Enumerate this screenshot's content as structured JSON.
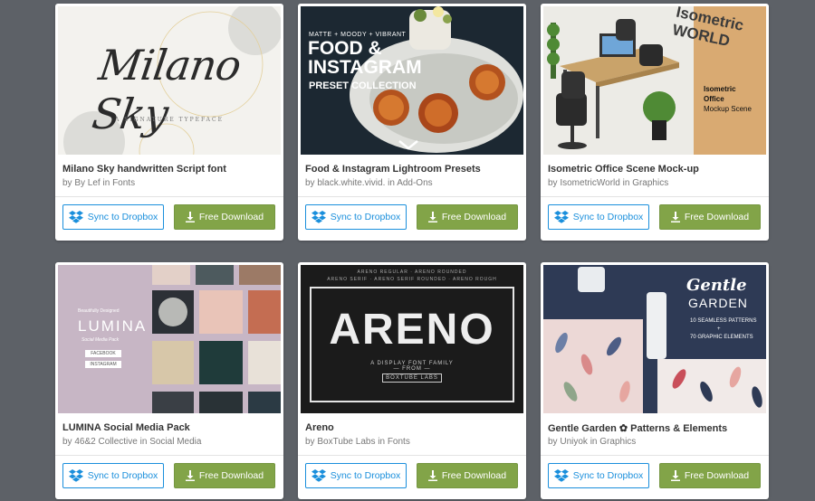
{
  "labels": {
    "sync": "Sync to Dropbox",
    "download": "Free Download"
  },
  "colors": {
    "background": "#5d6167",
    "sync_blue": "#1a8fdc",
    "download_green": "#82a448"
  },
  "cards": [
    {
      "title": "Milano Sky handwritten Script font",
      "by": "by",
      "author": "By Lef",
      "in": "in",
      "category": "Fonts",
      "thumb": {
        "script": "Milano Sky",
        "subtitle": "A SIGNATURE TYPEFACE"
      }
    },
    {
      "title": "Food & Instagram Lightroom Presets",
      "by": "by",
      "author": "black.white.vivid.",
      "in": "in",
      "category": "Add-Ons",
      "thumb": {
        "line1": "MATTE + MOODY + VIBRANT",
        "line2a": "FOOD &",
        "line2b": "INSTAGRAM",
        "line3": "PRESET COLLECTION"
      }
    },
    {
      "title": "Isometric Office Scene Mock-up",
      "by": "by",
      "author": "IsometricWorld",
      "in": "in",
      "category": "Graphics",
      "thumb": {
        "watermark_a": "Isometric",
        "watermark_b": "WORLD",
        "heading_a": "Isometric",
        "heading_b": "Office",
        "heading_c": "Mockup Scene"
      }
    },
    {
      "title": "LUMINA Social Media Pack",
      "by": "by",
      "author": "46&2 Collective",
      "in": "in",
      "category": "Social Media",
      "thumb": {
        "small": "Beautifully Designed",
        "name": "LUMINA",
        "sub": "Social Media Pack",
        "pill1": "FACEBOOK",
        "pill2": "INSTAGRAM"
      }
    },
    {
      "title": "Areno",
      "by": "by",
      "author": "BoxTube Labs",
      "in": "in",
      "category": "Fonts",
      "thumb": {
        "top1": "ARENO REGULAR · ARENO ROUNDED",
        "top2": "ARENO SERIF · ARENO SERIF ROUNDED · ARENO ROUGH",
        "name": "ARENO",
        "tagline": "A DISPLAY FONT FAMILY",
        "from": "— FROM —",
        "maker": "BOXTUBE LABS"
      }
    },
    {
      "title": "Gentle Garden ✿ Patterns & Elements",
      "by": "by",
      "author": "Uniyok",
      "in": "in",
      "category": "Graphics",
      "thumb": {
        "name_a": "Gentle",
        "name_b": "GARDEN",
        "detail1": "10 SEAMLESS PATTERNS",
        "detail2": "+",
        "detail3": "70 GRAPHIC ELEMENTS"
      }
    }
  ]
}
